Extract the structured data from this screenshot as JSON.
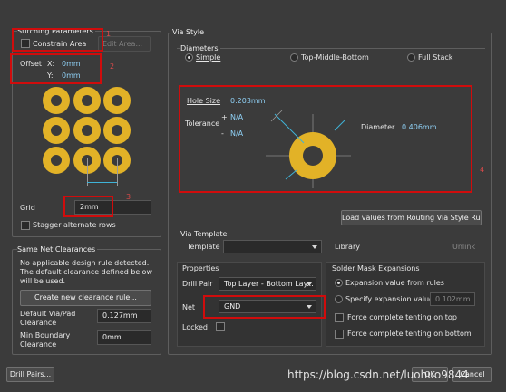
{
  "stitching": {
    "title": "Stitching Parameters",
    "constrain_area": "Constrain Area",
    "edit_area": "Edit Area...",
    "offset_label": "Offset",
    "x_label": "X:",
    "x_value": "0mm",
    "y_label": "Y:",
    "y_value": "0mm",
    "grid_label": "Grid",
    "grid_value": "2mm",
    "stagger": "Stagger alternate rows"
  },
  "net_clearances": {
    "title": "Same Net Clearances",
    "message": [
      "No applicable design rule detected.",
      "The default clearance defined below",
      "will be used."
    ],
    "create_button": "Create new clearance rule...",
    "default_label": [
      "Default Via/Pad",
      "Clearance"
    ],
    "default_value": "0.127mm",
    "min_label": [
      "Min Boundary",
      "Clearance"
    ],
    "min_value": "0mm"
  },
  "drill_pairs_button": "Drill Pairs...",
  "via_style": {
    "title": "Via Style",
    "diameters_title": "Diameters",
    "options": [
      "Simple",
      "Top-Middle-Bottom",
      "Full Stack"
    ],
    "hole_size_label": "Hole Size",
    "hole_size_value": "0.203mm",
    "tolerance_label": "Tolerance",
    "plus": "+",
    "minus": "-",
    "tol_plus": "N/A",
    "tol_minus": "N/A",
    "diameter_label": "Diameter",
    "diameter_value": "0.406mm",
    "load_button": "Load values from Routing Via Style Rule"
  },
  "via_template": {
    "title": "Via Template",
    "template_label": "Template",
    "template_value": "",
    "library_label": "Library",
    "unlink_button": "Unlink"
  },
  "properties": {
    "title": "Properties",
    "drill_pair_label": "Drill Pair",
    "drill_pair_value": "Top Layer - Bottom Lay...",
    "net_label": "Net",
    "net_value": "GND",
    "locked_label": "Locked"
  },
  "solder_mask": {
    "title": "Solder Mask Expansions",
    "from_rules": "Expansion value from rules",
    "specify": "Specify expansion value",
    "specify_value": "0.102mm",
    "tent_top": "Force complete tenting on top",
    "tent_bottom": "Force complete tenting on bottom"
  },
  "footer": {
    "ok": "OK",
    "cancel": "Cancel",
    "watermark": "https://blog.csdn.net/luohuo9844"
  },
  "annotations": [
    "1",
    "2",
    "3",
    "4"
  ],
  "colors": {
    "annotation_red": "#d00c0c",
    "via_gold": "#e2b227",
    "value_cyan": "#8fd0f5"
  }
}
